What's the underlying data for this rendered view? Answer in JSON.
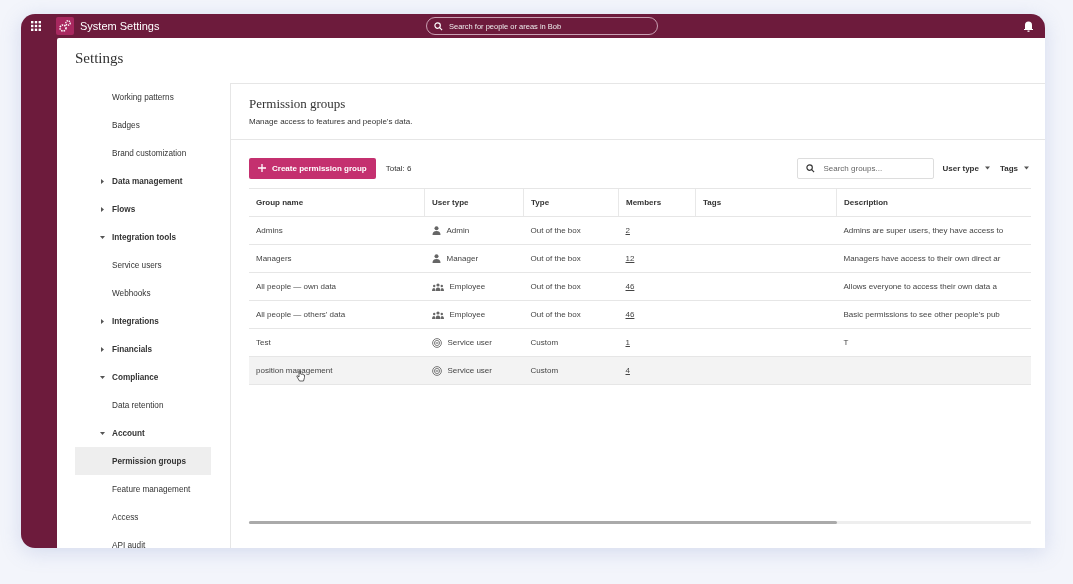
{
  "app_bar": {
    "title": "System Settings",
    "search": {
      "placeholder": "Search for people or areas in Bob"
    }
  },
  "page_title": "Settings",
  "sidebar": {
    "items": [
      {
        "label": "Working patterns",
        "selected": false
      },
      {
        "label": "Badges",
        "selected": false
      },
      {
        "label": "Brand customization",
        "selected": false
      },
      {
        "label": "Data management",
        "selected": false,
        "expanded": false
      },
      {
        "label": "Flows",
        "selected": false,
        "expanded": false
      },
      {
        "label": "Integration tools",
        "selected": false,
        "expanded": true,
        "children": [
          {
            "label": "Service users",
            "selected": false
          },
          {
            "label": "Webhooks",
            "selected": false
          }
        ]
      },
      {
        "label": "Integrations",
        "selected": false,
        "expanded": false
      },
      {
        "label": "Financials",
        "selected": false,
        "expanded": false
      },
      {
        "label": "Compliance",
        "selected": false,
        "expanded": true,
        "children": [
          {
            "label": "Data retention",
            "selected": false
          }
        ]
      },
      {
        "label": "Account",
        "selected": false,
        "expanded": true,
        "children": [
          {
            "label": "Permission groups",
            "selected": true
          },
          {
            "label": "Feature management",
            "selected": false
          },
          {
            "label": "Access",
            "selected": false
          },
          {
            "label": "API audit",
            "selected": false
          }
        ]
      }
    ]
  },
  "panel": {
    "title": "Permission groups",
    "subtitle": "Manage access to features and people's data.",
    "create_button": "Create permission group",
    "total": "Total: 6",
    "search": {
      "placeholder": "Search groups..."
    },
    "filters": [
      "User type",
      "Tags"
    ],
    "table": {
      "columns": [
        "Group name",
        "User type",
        "Type",
        "Members",
        "Tags",
        "Description"
      ],
      "rows": [
        {
          "group_name": "Admins",
          "user_type": {
            "kind": "person",
            "label": "Admin"
          },
          "type": "Out of the box",
          "members": "2",
          "description": "Admins are super users, they have access to",
          "hovered": false
        },
        {
          "group_name": "Managers",
          "user_type": {
            "kind": "person",
            "label": "Manager"
          },
          "type": "Out of the box",
          "members": "12",
          "description": "Managers have access to their own direct ar",
          "hovered": false
        },
        {
          "group_name": "All people — own data",
          "user_type": {
            "kind": "people",
            "label": "Employee"
          },
          "type": "Out of the box",
          "members": "46",
          "description": "Allows everyone to access their own data a",
          "hovered": false
        },
        {
          "group_name": "All people — others' data",
          "user_type": {
            "kind": "people",
            "label": "Employee"
          },
          "type": "Out of the box",
          "members": "46",
          "description": "Basic permissions to see other people's pub",
          "hovered": false
        },
        {
          "group_name": "Test",
          "user_type": {
            "kind": "service",
            "label": "Service user"
          },
          "type": "Custom",
          "members": "1",
          "description": "T",
          "hovered": false
        },
        {
          "group_name": "position management",
          "user_type": {
            "kind": "service",
            "label": "Service user"
          },
          "type": "Custom",
          "members": "4",
          "hovered": true
        }
      ]
    }
  }
}
